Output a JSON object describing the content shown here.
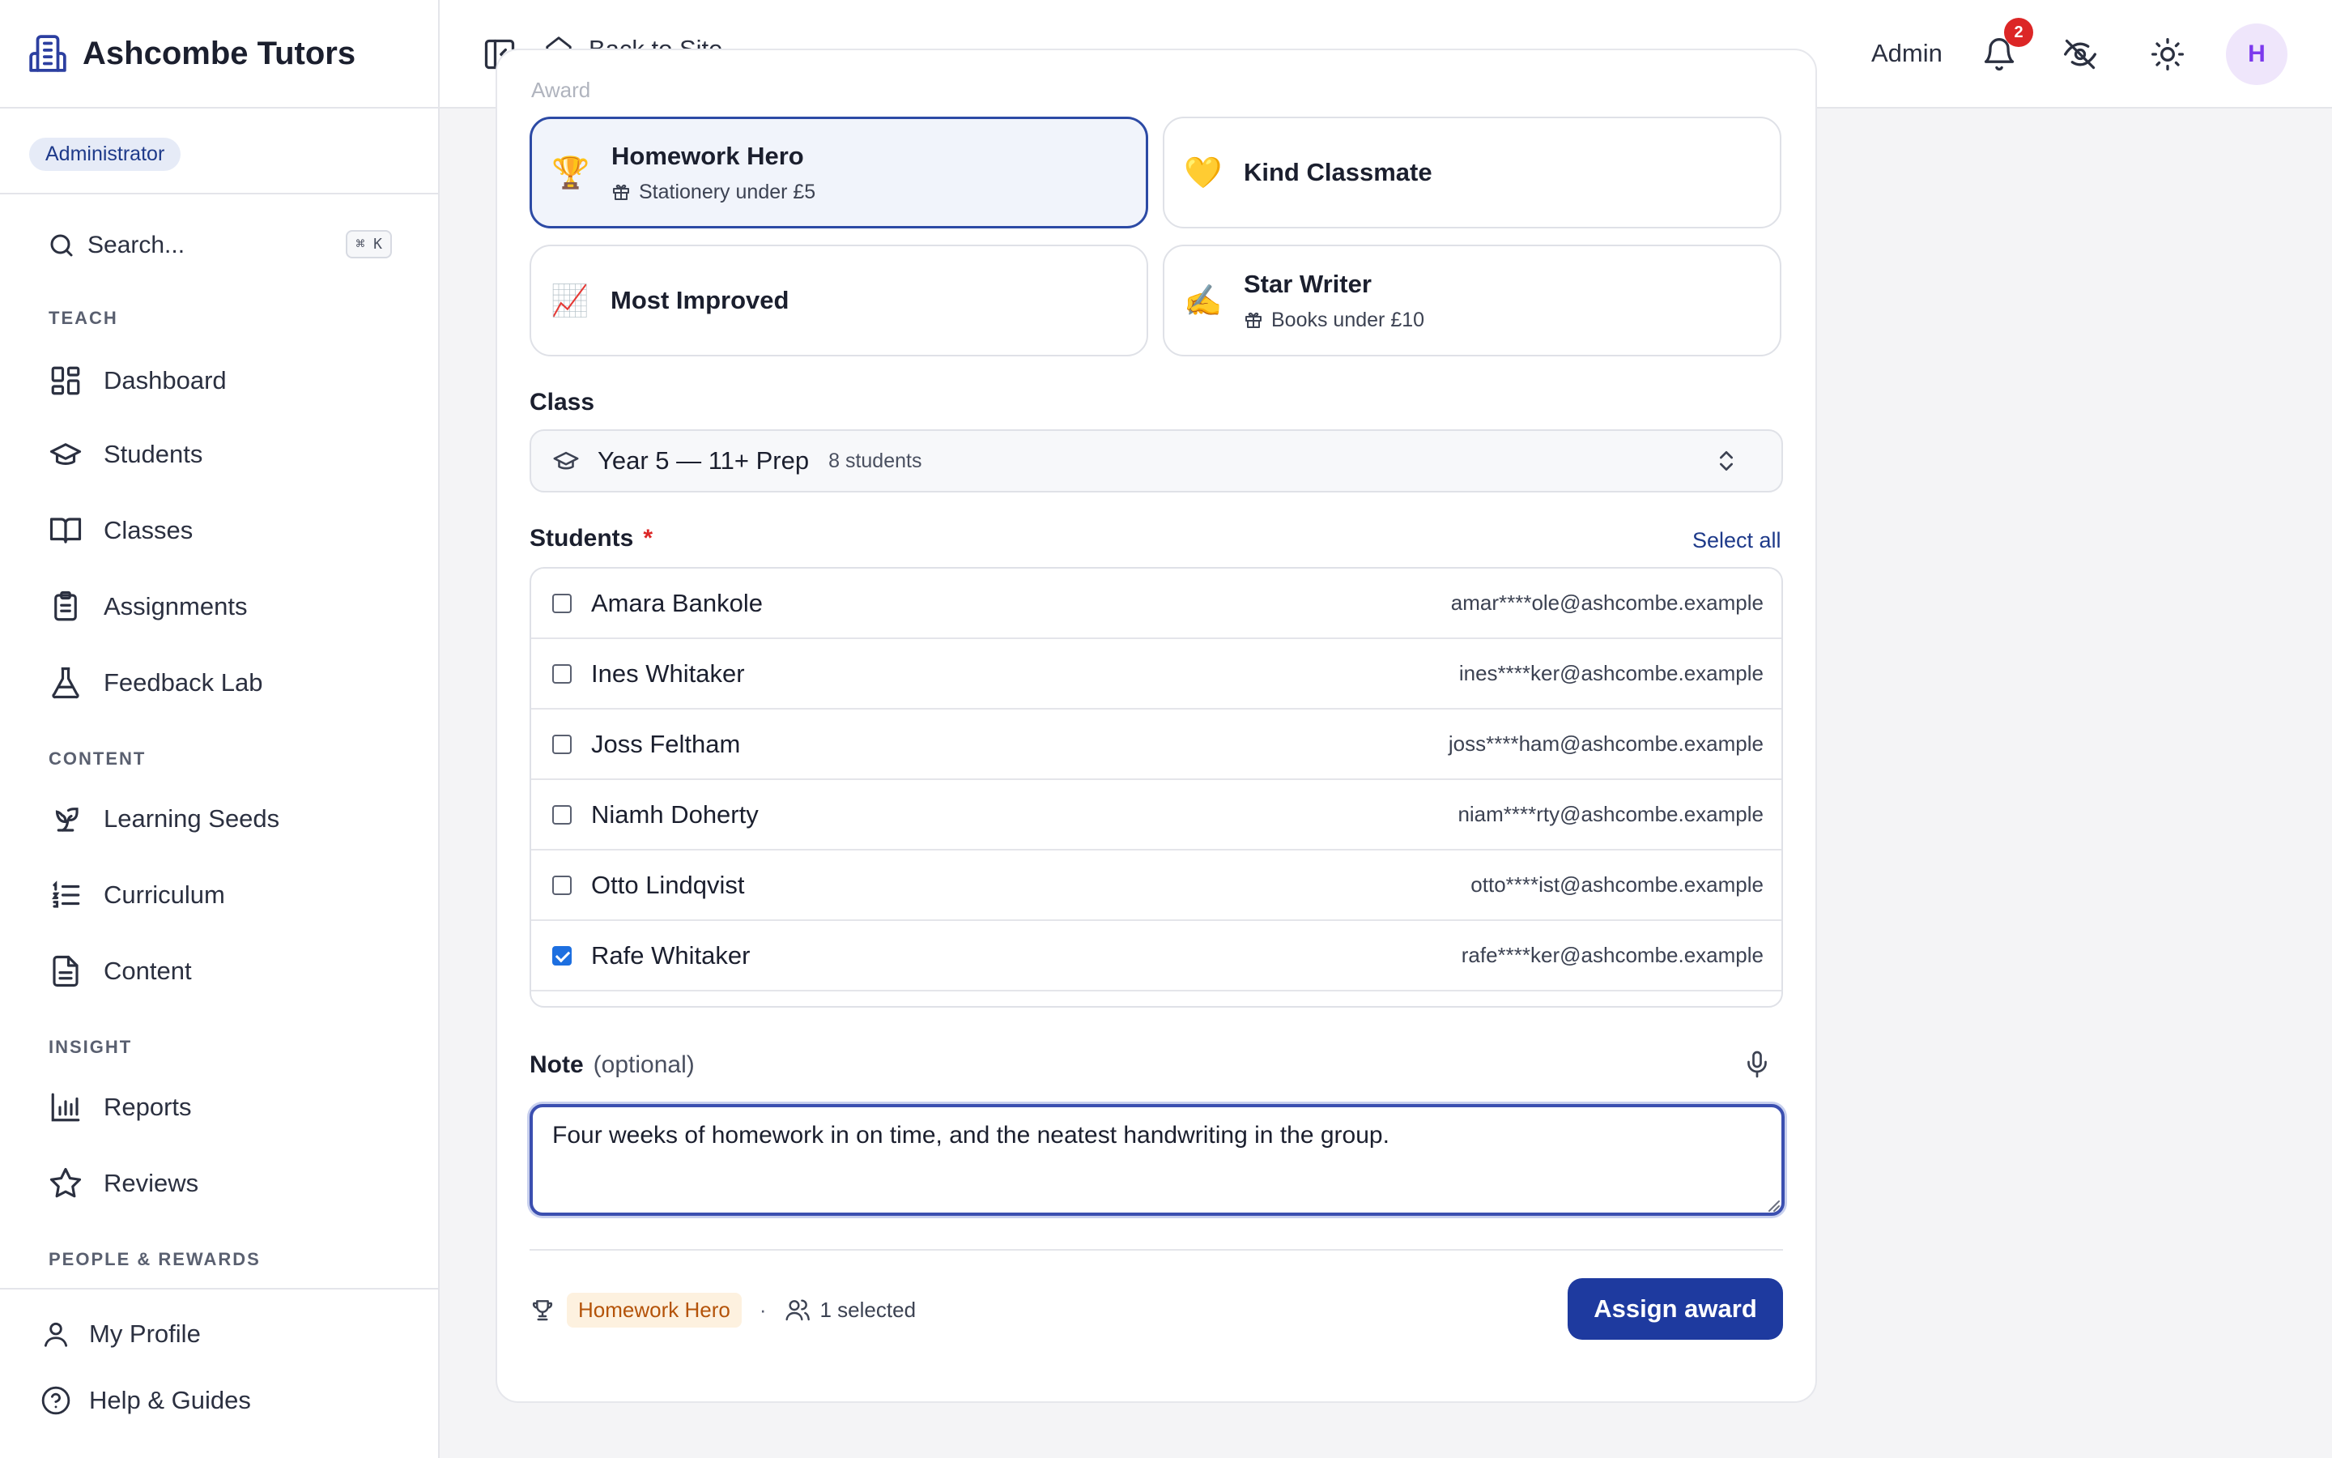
{
  "brand": {
    "title": "Ashcombe Tutors"
  },
  "role_badge": "Administrator",
  "search": {
    "label": "Search...",
    "shortcut": "⌘ K"
  },
  "sections": {
    "teach": "TEACH",
    "content": "CONTENT",
    "insight": "INSIGHT",
    "people": "PEOPLE & REWARDS"
  },
  "nav": {
    "dashboard": "Dashboard",
    "students": "Students",
    "classes": "Classes",
    "assignments": "Assignments",
    "feedback_lab": "Feedback Lab",
    "learning_seeds": "Learning Seeds",
    "curriculum": "Curriculum",
    "content": "Content",
    "reports": "Reports",
    "reviews": "Reviews"
  },
  "bottom_nav": {
    "profile": "My Profile",
    "help": "Help & Guides"
  },
  "topbar": {
    "back": "Back to Site",
    "admin": "Admin",
    "notifications": "2",
    "avatar": "H"
  },
  "form": {
    "awards_label": "Award",
    "awards": [
      {
        "emoji": "🏆",
        "name": "Homework Hero",
        "reward": "Stationery under £5",
        "selected": true
      },
      {
        "emoji": "💛",
        "name": "Kind Classmate",
        "reward": "",
        "selected": false
      },
      {
        "emoji": "📈",
        "name": "Most Improved",
        "reward": "",
        "selected": false
      },
      {
        "emoji": "✍️",
        "name": "Star Writer",
        "reward": "Books under £10",
        "selected": false
      }
    ],
    "class_label": "Class",
    "class_name": "Year 5 — 11+ Prep",
    "class_count": "8 students",
    "students_label": "Students",
    "required_mark": "*",
    "select_all": "Select all",
    "students": [
      {
        "name": "Amara Bankole",
        "email": "amar****ole@ashcombe.example",
        "checked": false
      },
      {
        "name": "Ines Whitaker",
        "email": "ines****ker@ashcombe.example",
        "checked": false
      },
      {
        "name": "Joss Feltham",
        "email": "joss****ham@ashcombe.example",
        "checked": false
      },
      {
        "name": "Niamh Doherty",
        "email": "niam****rty@ashcombe.example",
        "checked": false
      },
      {
        "name": "Otto Lindqvist",
        "email": "otto****ist@ashcombe.example",
        "checked": false
      },
      {
        "name": "Rafe Whitaker",
        "email": "rafe****ker@ashcombe.example",
        "checked": true
      }
    ],
    "note_label": "Note",
    "note_optional": "(optional)",
    "note_value": "Four weeks of homework in on time, and the neatest handwriting in the group."
  },
  "footer": {
    "selected_award": "Homework Hero",
    "dot": "·",
    "selected_count": "1 selected",
    "assign_label": "Assign award"
  }
}
